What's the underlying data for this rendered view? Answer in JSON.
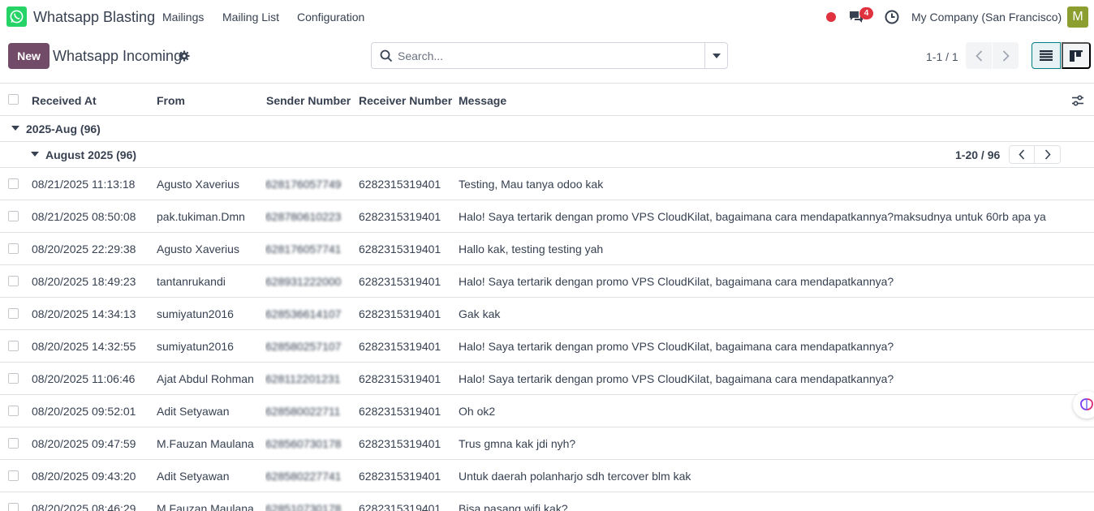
{
  "navbar": {
    "app_name": "Whatsapp Blasting",
    "menu": [
      "Mailings",
      "Mailing List",
      "Configuration"
    ],
    "chat_count": "4",
    "company": "My Company (San Francisco)",
    "avatar_letter": "M"
  },
  "control": {
    "new_label": "New",
    "title": "Whatsapp Incoming",
    "search_placeholder": "Search...",
    "pager": "1-1 / 1"
  },
  "columns": [
    "Received At",
    "From",
    "Sender Number",
    "Receiver Number",
    "Message"
  ],
  "groups": {
    "year": "2025-Aug (96)",
    "month": "August 2025 (96)",
    "month_pager": "1-20 / 96"
  },
  "rows": [
    {
      "received": "08/21/2025 11:13:18",
      "from": "Agusto Xaverius",
      "sender": "628176057749",
      "receiver": "6282315319401",
      "message": "Testing, Mau tanya odoo kak"
    },
    {
      "received": "08/21/2025 08:50:08",
      "from": "pak.tukiman.Dmn",
      "sender": "628780610223",
      "receiver": "6282315319401",
      "message": "Halo! Saya tertarik dengan promo VPS CloudKilat, bagaimana cara mendapatkannya?maksudnya untuk 60rb apa ya"
    },
    {
      "received": "08/20/2025 22:29:38",
      "from": "Agusto Xaverius",
      "sender": "628176057741",
      "receiver": "6282315319401",
      "message": "Hallo kak, testing testing yah"
    },
    {
      "received": "08/20/2025 18:49:23",
      "from": "tantanrukandi",
      "sender": "628931222000",
      "receiver": "6282315319401",
      "message": "Halo! Saya tertarik dengan promo VPS CloudKilat, bagaimana cara mendapatkannya?"
    },
    {
      "received": "08/20/2025 14:34:13",
      "from": "sumiyatun2016",
      "sender": "628536614107",
      "receiver": "6282315319401",
      "message": "Gak kak"
    },
    {
      "received": "08/20/2025 14:32:55",
      "from": "sumiyatun2016",
      "sender": "628580257107",
      "receiver": "6282315319401",
      "message": "Halo! Saya tertarik dengan promo VPS CloudKilat, bagaimana cara mendapatkannya?"
    },
    {
      "received": "08/20/2025 11:06:46",
      "from": "Ajat Abdul Rohman",
      "sender": "628112201231",
      "receiver": "6282315319401",
      "message": "Halo! Saya tertarik dengan promo VPS CloudKilat, bagaimana cara mendapatkannya?"
    },
    {
      "received": "08/20/2025 09:52:01",
      "from": "Adit Setyawan",
      "sender": "628580022711",
      "receiver": "6282315319401",
      "message": "Oh ok2"
    },
    {
      "received": "08/20/2025 09:47:59",
      "from": "M.Fauzan Maulana",
      "sender": "628560730178",
      "receiver": "6282315319401",
      "message": "Trus gmna kak jdi nyh?"
    },
    {
      "received": "08/20/2025 09:43:20",
      "from": "Adit Setyawan",
      "sender": "628580227741",
      "receiver": "6282315319401",
      "message": "Untuk daerah polanharjo sdh tercover blm kak"
    },
    {
      "received": "08/20/2025 08:46:29",
      "from": "M.Fauzan Maulana",
      "sender": "628510730178",
      "receiver": "6282315319401",
      "message": "Bisa pasang wifi kak?"
    }
  ]
}
